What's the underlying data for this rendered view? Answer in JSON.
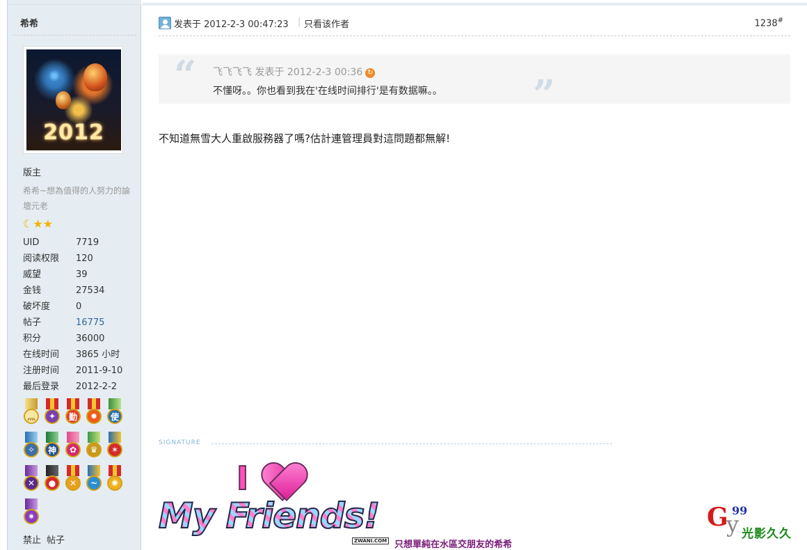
{
  "colors": {
    "sidebar_bg": "#e5edf2",
    "link": "#336699",
    "quote_bg": "#f5f5f5",
    "signature_caption": "#7a1a7a"
  },
  "author": {
    "name": "希希"
  },
  "avatar": {
    "year_text": "2012"
  },
  "profile": {
    "rank": "版主",
    "custom_title": "希希~想為值得的人努力的論壇元老",
    "stars_icons": [
      "moon-icon",
      "star-icon",
      "star-icon"
    ],
    "stats": [
      {
        "label": "UID",
        "value": "7719"
      },
      {
        "label": "阅读权限",
        "value": "120"
      },
      {
        "label": "威望",
        "value": "39"
      },
      {
        "label": "金钱",
        "value": "27534"
      },
      {
        "label": "破坏度",
        "value": "0"
      },
      {
        "label": "帖子",
        "value": "16775"
      },
      {
        "label": "积分",
        "value": "36000"
      },
      {
        "label": "在线时间",
        "value": "3865 小时"
      },
      {
        "label": "注册时间",
        "value": "2011-9-10"
      },
      {
        "label": "最后登录",
        "value": "2012-2-2"
      }
    ],
    "medal_glyphs": [
      "灬",
      "✦",
      "勤",
      "✹",
      "使",
      "✧",
      "神",
      "✿",
      "♛",
      "✶",
      "✕",
      "●",
      "✕",
      "~",
      "✺",
      "✷"
    ],
    "actions": {
      "ban": "禁止",
      "posts": "帖子"
    }
  },
  "post": {
    "posted_at": "发表于 2012-2-3 00:47:23",
    "only_author": "只看该作者",
    "floor": "1238",
    "floor_mark": "#",
    "quote": {
      "meta": "飞飞飞飞 发表于 2012-2-3 00:36",
      "text": "不懂呀。。你也看到我在'在线时间排行'是有数据嘛。。"
    },
    "message": "不知道無雪大人重啟服務器了嗎?估計連管理員對這問題都無解!",
    "signature": {
      "label": "SIGNATURE",
      "image_line1": "I",
      "image_line2": "My Friends!",
      "image_credit": "ZWANI.COM",
      "caption": "只想單純在水區交朋友的希希"
    }
  },
  "watermark": {
    "g": "G",
    "y": "y",
    "num": "99",
    "text": "光影久久"
  }
}
